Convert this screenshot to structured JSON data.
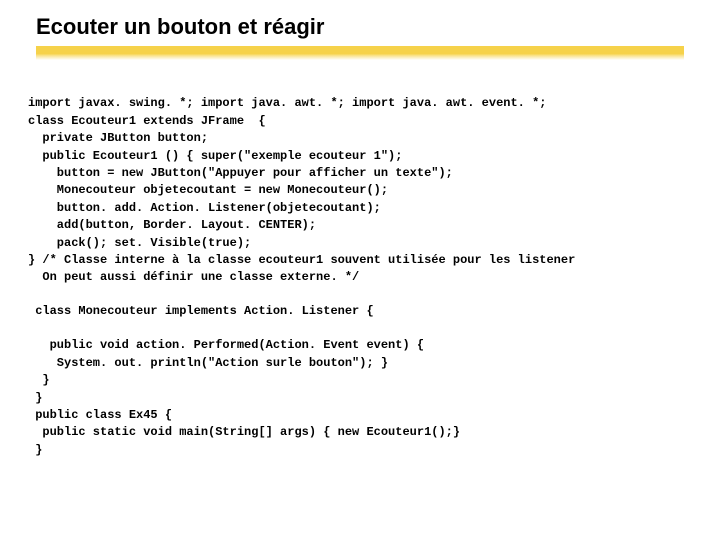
{
  "title": "Ecouter un bouton et réagir",
  "code": {
    "l1": "import javax. swing. *; import java. awt. *; import java. awt. event. *;",
    "l2": "class Ecouteur1 extends JFrame  {",
    "l3": "  private JButton button;",
    "l4": "  public Ecouteur1 () { super(\"exemple ecouteur 1\");",
    "l5": "    button = new JButton(\"Appuyer pour afficher un texte\");",
    "l6": "    Monecouteur objetecoutant = new Monecouteur();",
    "l7": "    button. add. Action. Listener(objetecoutant);",
    "l8": "    add(button, Border. Layout. CENTER);",
    "l9": "    pack(); set. Visible(true);",
    "l10": "} /* Classe interne à la classe ecouteur1 souvent utilisée pour les listener",
    "l11": "  On peut aussi définir une classe externe. */",
    "l12": " class Monecouteur implements Action. Listener {",
    "l13": "   public void action. Performed(Action. Event event) {",
    "l14": "    System. out. println(\"Action surle bouton\"); }",
    "l15": "  }",
    "l16": " }",
    "l17": " public class Ex45 {",
    "l18": "  public static void main(String[] args) { new Ecouteur1();}",
    "l19": " }"
  }
}
